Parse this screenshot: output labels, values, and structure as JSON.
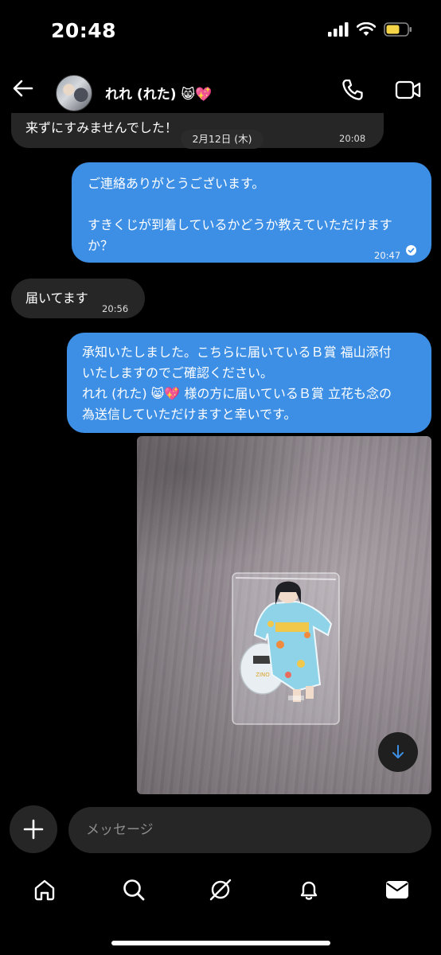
{
  "status_bar": {
    "time": "20:48"
  },
  "header": {
    "contact_name": "れれ (れた) 😸💖"
  },
  "date_chip": "2月12日 (木)",
  "messages": [
    {
      "direction": "in",
      "text": "来ずにすみませんでした！",
      "time": "20:08"
    },
    {
      "direction": "out",
      "lines": [
        "ご連絡ありがとうございます。",
        "",
        "すきくじが到着しているかどうか教えていただけます",
        "か？"
      ],
      "time": "20:47",
      "status": "sent-check"
    },
    {
      "direction": "in",
      "text": "届いてます",
      "time": "20:56"
    },
    {
      "direction": "out",
      "lines": [
        "承知いたしました。こちらに届いているＢ賞 福山添付",
        "いたしますのでご確認ください。",
        "れれ (れた) 😸💖 様の方に届いているＢ賞 立花も念の",
        "為送信していただけますと幸いです。"
      ]
    },
    {
      "direction": "out",
      "type": "photo",
      "description_label": "ZINO"
    }
  ],
  "composer": {
    "placeholder": "メッセージ"
  },
  "colors": {
    "outgoing_bubble": "#3d8fe5",
    "incoming_bubble": "#262626",
    "background": "#000000"
  },
  "icons": {
    "tabs": [
      "home-icon",
      "search-icon",
      "explore-icon",
      "notifications-bell-icon",
      "messages-icon"
    ]
  }
}
